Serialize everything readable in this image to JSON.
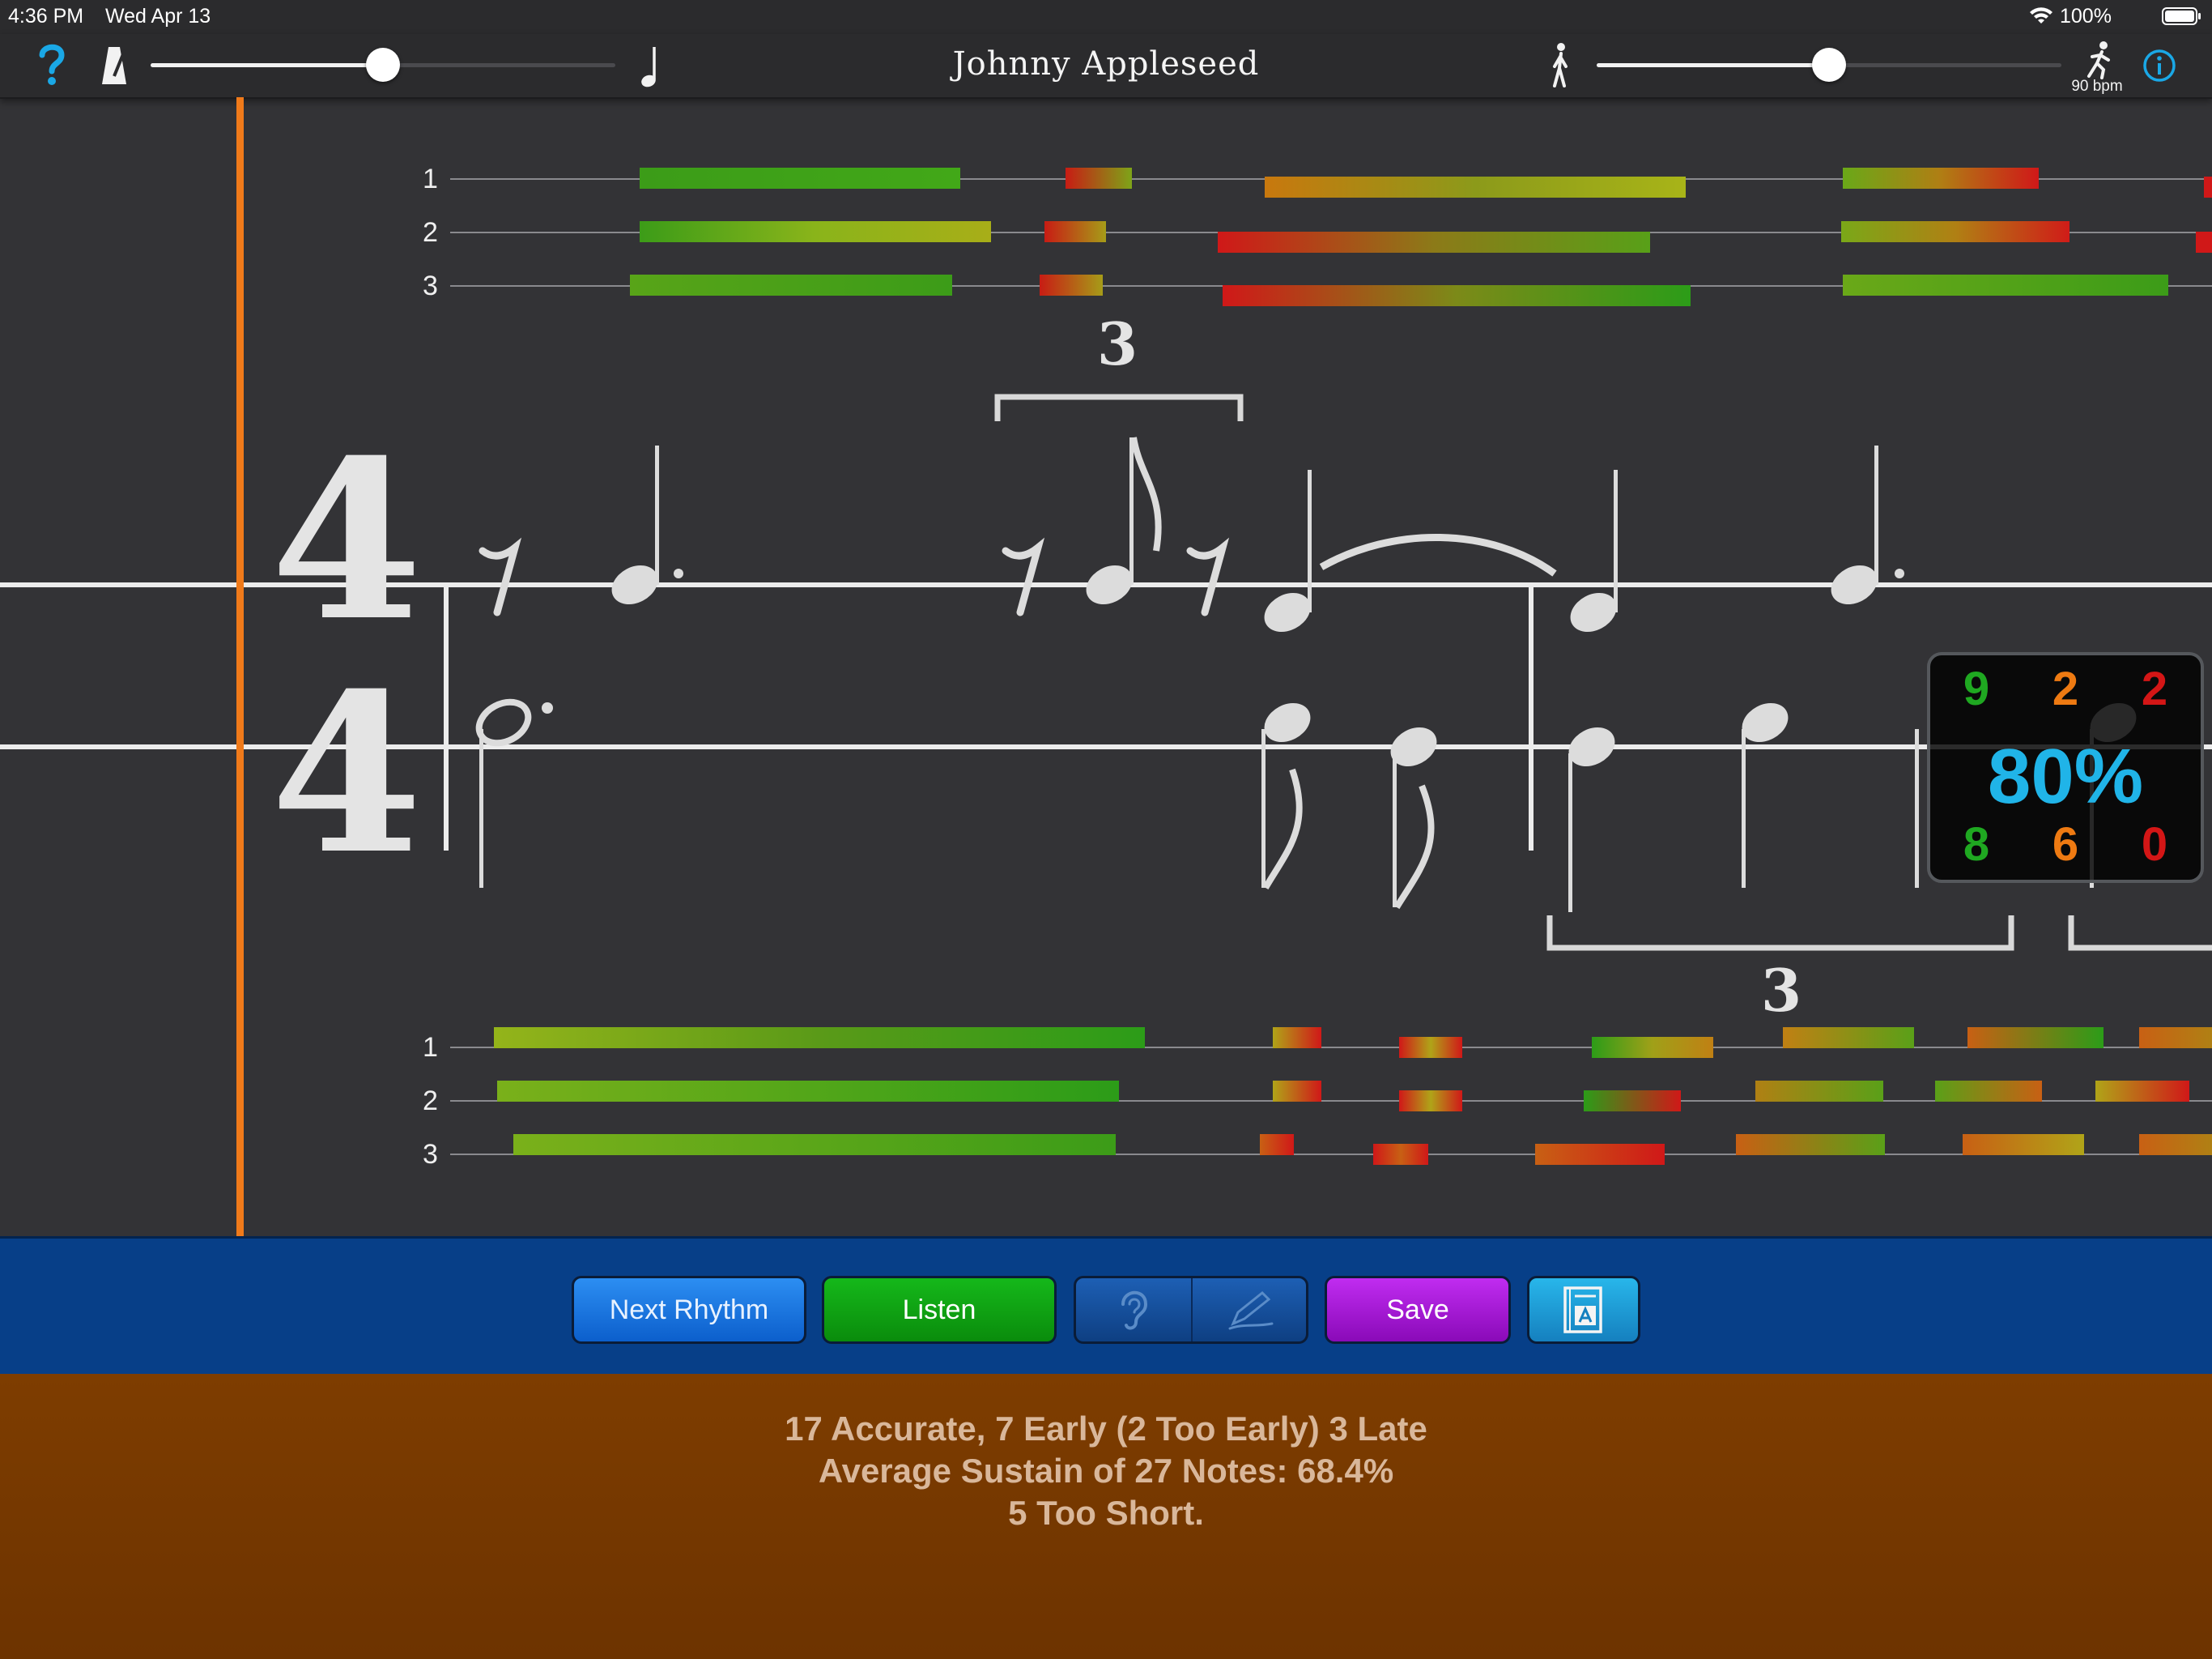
{
  "status_bar": {
    "time": "4:36 PM",
    "date": "Wed Apr 13",
    "battery": "100%"
  },
  "toolbar": {
    "song_title": "Johnny Appleseed",
    "volume_level": 0.5,
    "tempo_level": 0.5,
    "tempo_label": "90 bpm",
    "help_icon": "question-mark-icon",
    "info_icon": "info-circle-icon"
  },
  "score": {
    "time_signature_top": "4",
    "time_signature_bottom": "4",
    "tuplet_label_top": "3",
    "tuplet_label_bottom": "3",
    "upper_lane_labels": [
      "1",
      "2",
      "3"
    ],
    "lower_lane_labels": [
      "1",
      "2",
      "3"
    ]
  },
  "summary": {
    "top": [
      "9",
      "2",
      "2"
    ],
    "percent": "80%",
    "bottom": [
      "8",
      "6",
      "0"
    ],
    "colors": {
      "accurate": "#1fa821",
      "early": "#ee7a12",
      "late": "#d41616",
      "percent": "#20b4e8"
    }
  },
  "buttons": {
    "next_rhythm": "Next Rhythm",
    "listen": "Listen",
    "ear_icon": "ear-icon",
    "pencil_icon": "pencil-icon",
    "save": "Save",
    "book_icon": "dictionary-book-icon"
  },
  "results": {
    "line1": "17 Accurate, 7 Early (2 Too Early) 3 Late",
    "line2": "Average Sustain of 27 Notes: 68.4%",
    "line3": "5 Too Short."
  },
  "colors": {
    "playhead": "#f07a1a",
    "button_bar": "#073f88",
    "results_bg": "#7e3d00"
  }
}
